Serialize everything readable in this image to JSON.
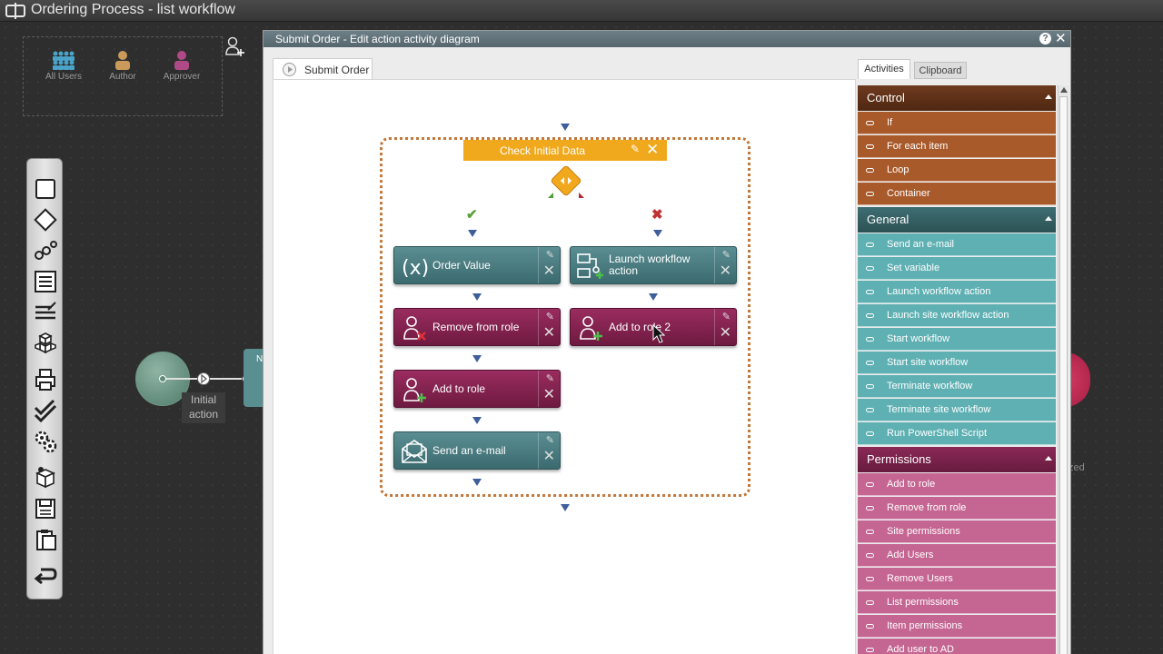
{
  "app": {
    "title": "Ordering Process - list workflow"
  },
  "roles": [
    {
      "label": "All Users",
      "color": "#4aa3c8"
    },
    {
      "label": "Author",
      "color": "#c99a5a"
    },
    {
      "label": "Approver",
      "color": "#b04a86"
    }
  ],
  "workflow": {
    "start_label": "Initial action",
    "peek_label": "N",
    "end_label": "zed"
  },
  "dialog": {
    "title": "Submit Order - Edit action activity diagram",
    "help": "?",
    "close": "✕",
    "diagram_tab": "Submit Order"
  },
  "diagram": {
    "check_node": {
      "label": "Check Initial Data",
      "edit": "✎",
      "close": "✕"
    },
    "branch_yes": "✔",
    "branch_no": "✖",
    "activities": {
      "order_value": "Order Value",
      "launch_workflow": "Launch workflow action",
      "remove_from_role": "Remove from role",
      "add_to_role_2": "Add to role 2",
      "add_to_role": "Add to role",
      "send_email": "Send an e-mail"
    },
    "edit": "✎",
    "delete": "✕"
  },
  "panel": {
    "tabs": {
      "activities": "Activities",
      "clipboard": "Clipboard"
    },
    "groups": {
      "control": {
        "title": "Control",
        "items": [
          "If",
          "For each item",
          "Loop",
          "Container"
        ]
      },
      "general": {
        "title": "General",
        "items": [
          "Send an e-mail",
          "Set variable",
          "Launch workflow action",
          "Launch site workflow action",
          "Start workflow",
          "Start site workflow",
          "Terminate workflow",
          "Terminate site workflow",
          "Run PowerShell Script"
        ]
      },
      "permissions": {
        "title": "Permissions",
        "items": [
          "Add to role",
          "Remove from role",
          "Site permissions",
          "Add Users",
          "Remove Users",
          "List permissions",
          "Item permissions",
          "Add user to AD"
        ]
      }
    }
  }
}
